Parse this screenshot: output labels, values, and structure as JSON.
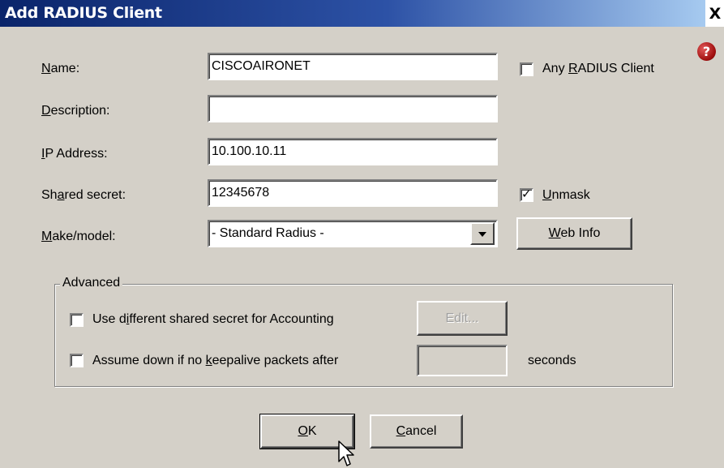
{
  "window": {
    "title": "Add RADIUS Client",
    "close_glyph": "X"
  },
  "help_icon": "help-icon",
  "fields": {
    "name": {
      "label": "Name:",
      "value": "CISCOAIRONET"
    },
    "description": {
      "label": "Description:",
      "value": ""
    },
    "ip_address": {
      "label": "IP Address:",
      "value": "10.100.10.11"
    },
    "shared_secret": {
      "label": "Shared secret:",
      "value": "12345678"
    },
    "make_model": {
      "label": "Make/model:",
      "value": "- Standard Radius -"
    }
  },
  "checkboxes": {
    "any_radius_client": {
      "label": "Any RADIUS Client",
      "checked": false
    },
    "unmask": {
      "label": "Unmask",
      "checked": true
    }
  },
  "buttons": {
    "web_info": "Web Info",
    "ok": "OK",
    "cancel": "Cancel"
  },
  "advanced": {
    "title": "Advanced",
    "accounting_label": "Use different shared secret for Accounting",
    "accounting_checked": false,
    "edit_label": "Edit...",
    "keepalive_label": "Assume down if no keepalive packets after",
    "keepalive_checked": false,
    "keepalive_value": "",
    "seconds_label": "seconds"
  }
}
